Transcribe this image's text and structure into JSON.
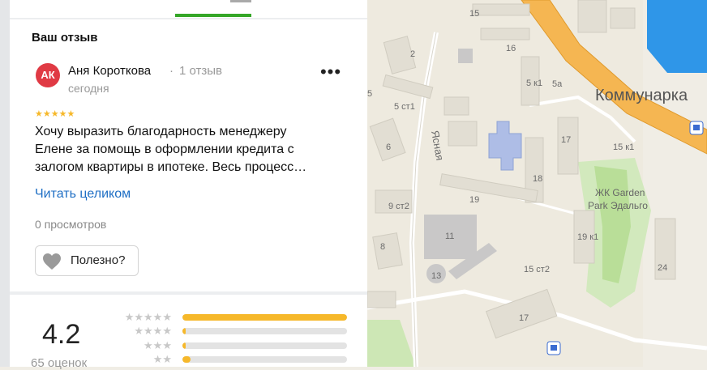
{
  "review": {
    "section_title": "Ваш отзыв",
    "avatar_initials": "АК",
    "avatar_color": "#e03a44",
    "author_name": "Аня Короткова",
    "separator": "·",
    "author_reviews": "1 отзыв",
    "date": "сегодня",
    "stars_text": "★★★★★",
    "rating": 5,
    "text_lines": [
      "Хочу выразить благодарность менеджеру",
      "Елене за помощь в оформлении кредита с",
      "залогом квартиры в ипотеке. Весь процесс…"
    ],
    "read_more": "Читать целиком",
    "views": "0 просмотров",
    "helpful_label": "Полезно?",
    "more_label": "•••"
  },
  "rating_summary": {
    "value": "4.2",
    "count": "65 оценок",
    "distribution": [
      {
        "stars": 5,
        "label": "★★★★★",
        "fraction": 1.0
      },
      {
        "stars": 4,
        "label": "★★★★",
        "fraction": 0.02
      },
      {
        "stars": 3,
        "label": "★★★",
        "fraction": 0.01
      },
      {
        "stars": 2,
        "label": "★★",
        "fraction": 0.05
      }
    ]
  },
  "map": {
    "district_label": "Коммунарка",
    "street_label": "Ясная",
    "complex_label_line1": "ЖК Garden",
    "complex_label_line2": "Park Эдальго",
    "house_numbers": [
      "15",
      "16",
      "2",
      "5 к1",
      "5а",
      "5",
      "5 ст1",
      "17",
      "6",
      "15 к1",
      "18",
      "9 ст2",
      "19",
      "19 к1",
      "11",
      "8",
      "15 ст2",
      "24",
      "13",
      "17"
    ]
  },
  "colors": {
    "accent_green": "#35a627",
    "star_yellow": "#f6b82a",
    "link_blue": "#1e6ec4",
    "road_orange": "#f5b652",
    "water_blue": "#2f96e8"
  }
}
